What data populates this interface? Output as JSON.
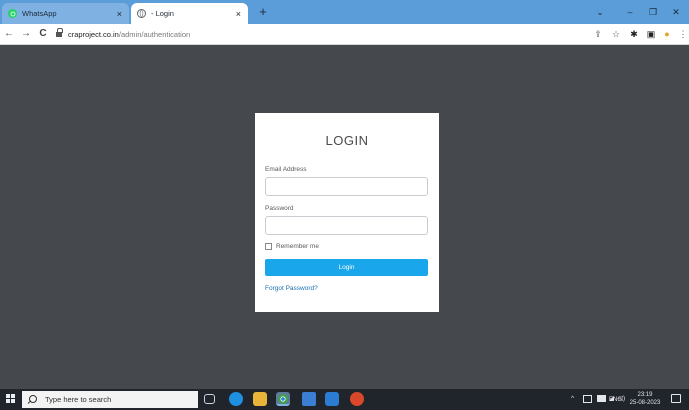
{
  "browser": {
    "tabs": [
      {
        "title": "WhatsApp",
        "icon": "whatsapp-icon",
        "color": "#25d366"
      },
      {
        "title": "- Login",
        "icon": "globe-icon",
        "color": "#5f6368"
      }
    ],
    "tab_close": "×",
    "new_tab": "+",
    "window_controls": {
      "chevron": "⌄",
      "minimize": "–",
      "maximize": "❐",
      "close": "✕"
    },
    "nav": {
      "back": "←",
      "forward": "→",
      "reload": "C"
    },
    "url_host": "craproject.co.in",
    "url_path": "/admin/authentication",
    "toolbar_icons": {
      "share": "⇪",
      "star": "☆",
      "extensions": "✱",
      "sidebar": "▣",
      "profile": "●",
      "menu": "⋮"
    }
  },
  "login": {
    "title": "LOGIN",
    "email_label": "Email Address",
    "email_value": "",
    "password_label": "Password",
    "password_value": "",
    "remember_label": "Remember me",
    "login_button": "Login",
    "forgot_link": "Forgot Password?",
    "accent": "#1aa6ea"
  },
  "taskbar": {
    "search_placeholder": "Type here to search",
    "tray_chevron": "^",
    "language": "ENG",
    "time": "23:19",
    "date": "25-08-2023"
  }
}
